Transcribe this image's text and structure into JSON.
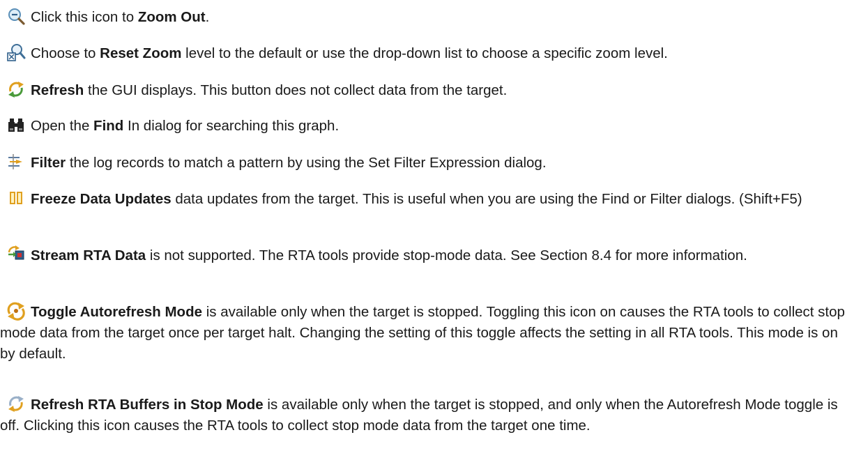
{
  "entries": [
    {
      "icon": "zoom-out-icon",
      "pre": "Click this icon to ",
      "bold": "Zoom Out",
      "post": "."
    },
    {
      "icon": "reset-zoom-icon",
      "pre": "Choose to ",
      "bold": "Reset Zoom",
      "post": " level to the default or use the drop-down list to choose a specific zoom level."
    },
    {
      "icon": "refresh-icon",
      "pre": "",
      "bold": "Refresh",
      "post": " the GUI displays. This button does not collect data from the target."
    },
    {
      "icon": "binoculars-icon",
      "pre": "Open the ",
      "bold": "Find",
      "post": " In dialog for searching this graph."
    },
    {
      "icon": "filter-icon",
      "pre": "",
      "bold": "Filter",
      "post": " the log records to match a pattern by using the Set Filter Expression dialog."
    },
    {
      "icon": "pause-icon",
      "pre": "",
      "bold": "Freeze Data Updates",
      "post": " data updates from the target. This is useful when you are using the Find or Filter dialogs. (Shift+F5)"
    },
    {
      "icon": "stream-icon",
      "pre": "",
      "bold": "Stream RTA Data",
      "post": " is not supported. The RTA tools provide stop-mode data. See Section 8.4 for more information."
    },
    {
      "icon": "autorefresh-icon",
      "pre": "",
      "bold": "Toggle Autorefresh Mode",
      "post": " is available only when the target is stopped. Toggling this icon on causes the RTA tools to collect stop mode data from the target once per target halt. Changing the setting of this toggle affects the setting in all RTA tools. This mode is on by default."
    },
    {
      "icon": "refresh-buffers-icon",
      "pre": "",
      "bold": "Refresh RTA Buffers in Stop Mode",
      "post": " is available only when the target is stopped, and only when the Autorefresh Mode toggle is off. Clicking this icon causes the RTA tools to collect stop mode data from the target one time."
    }
  ]
}
